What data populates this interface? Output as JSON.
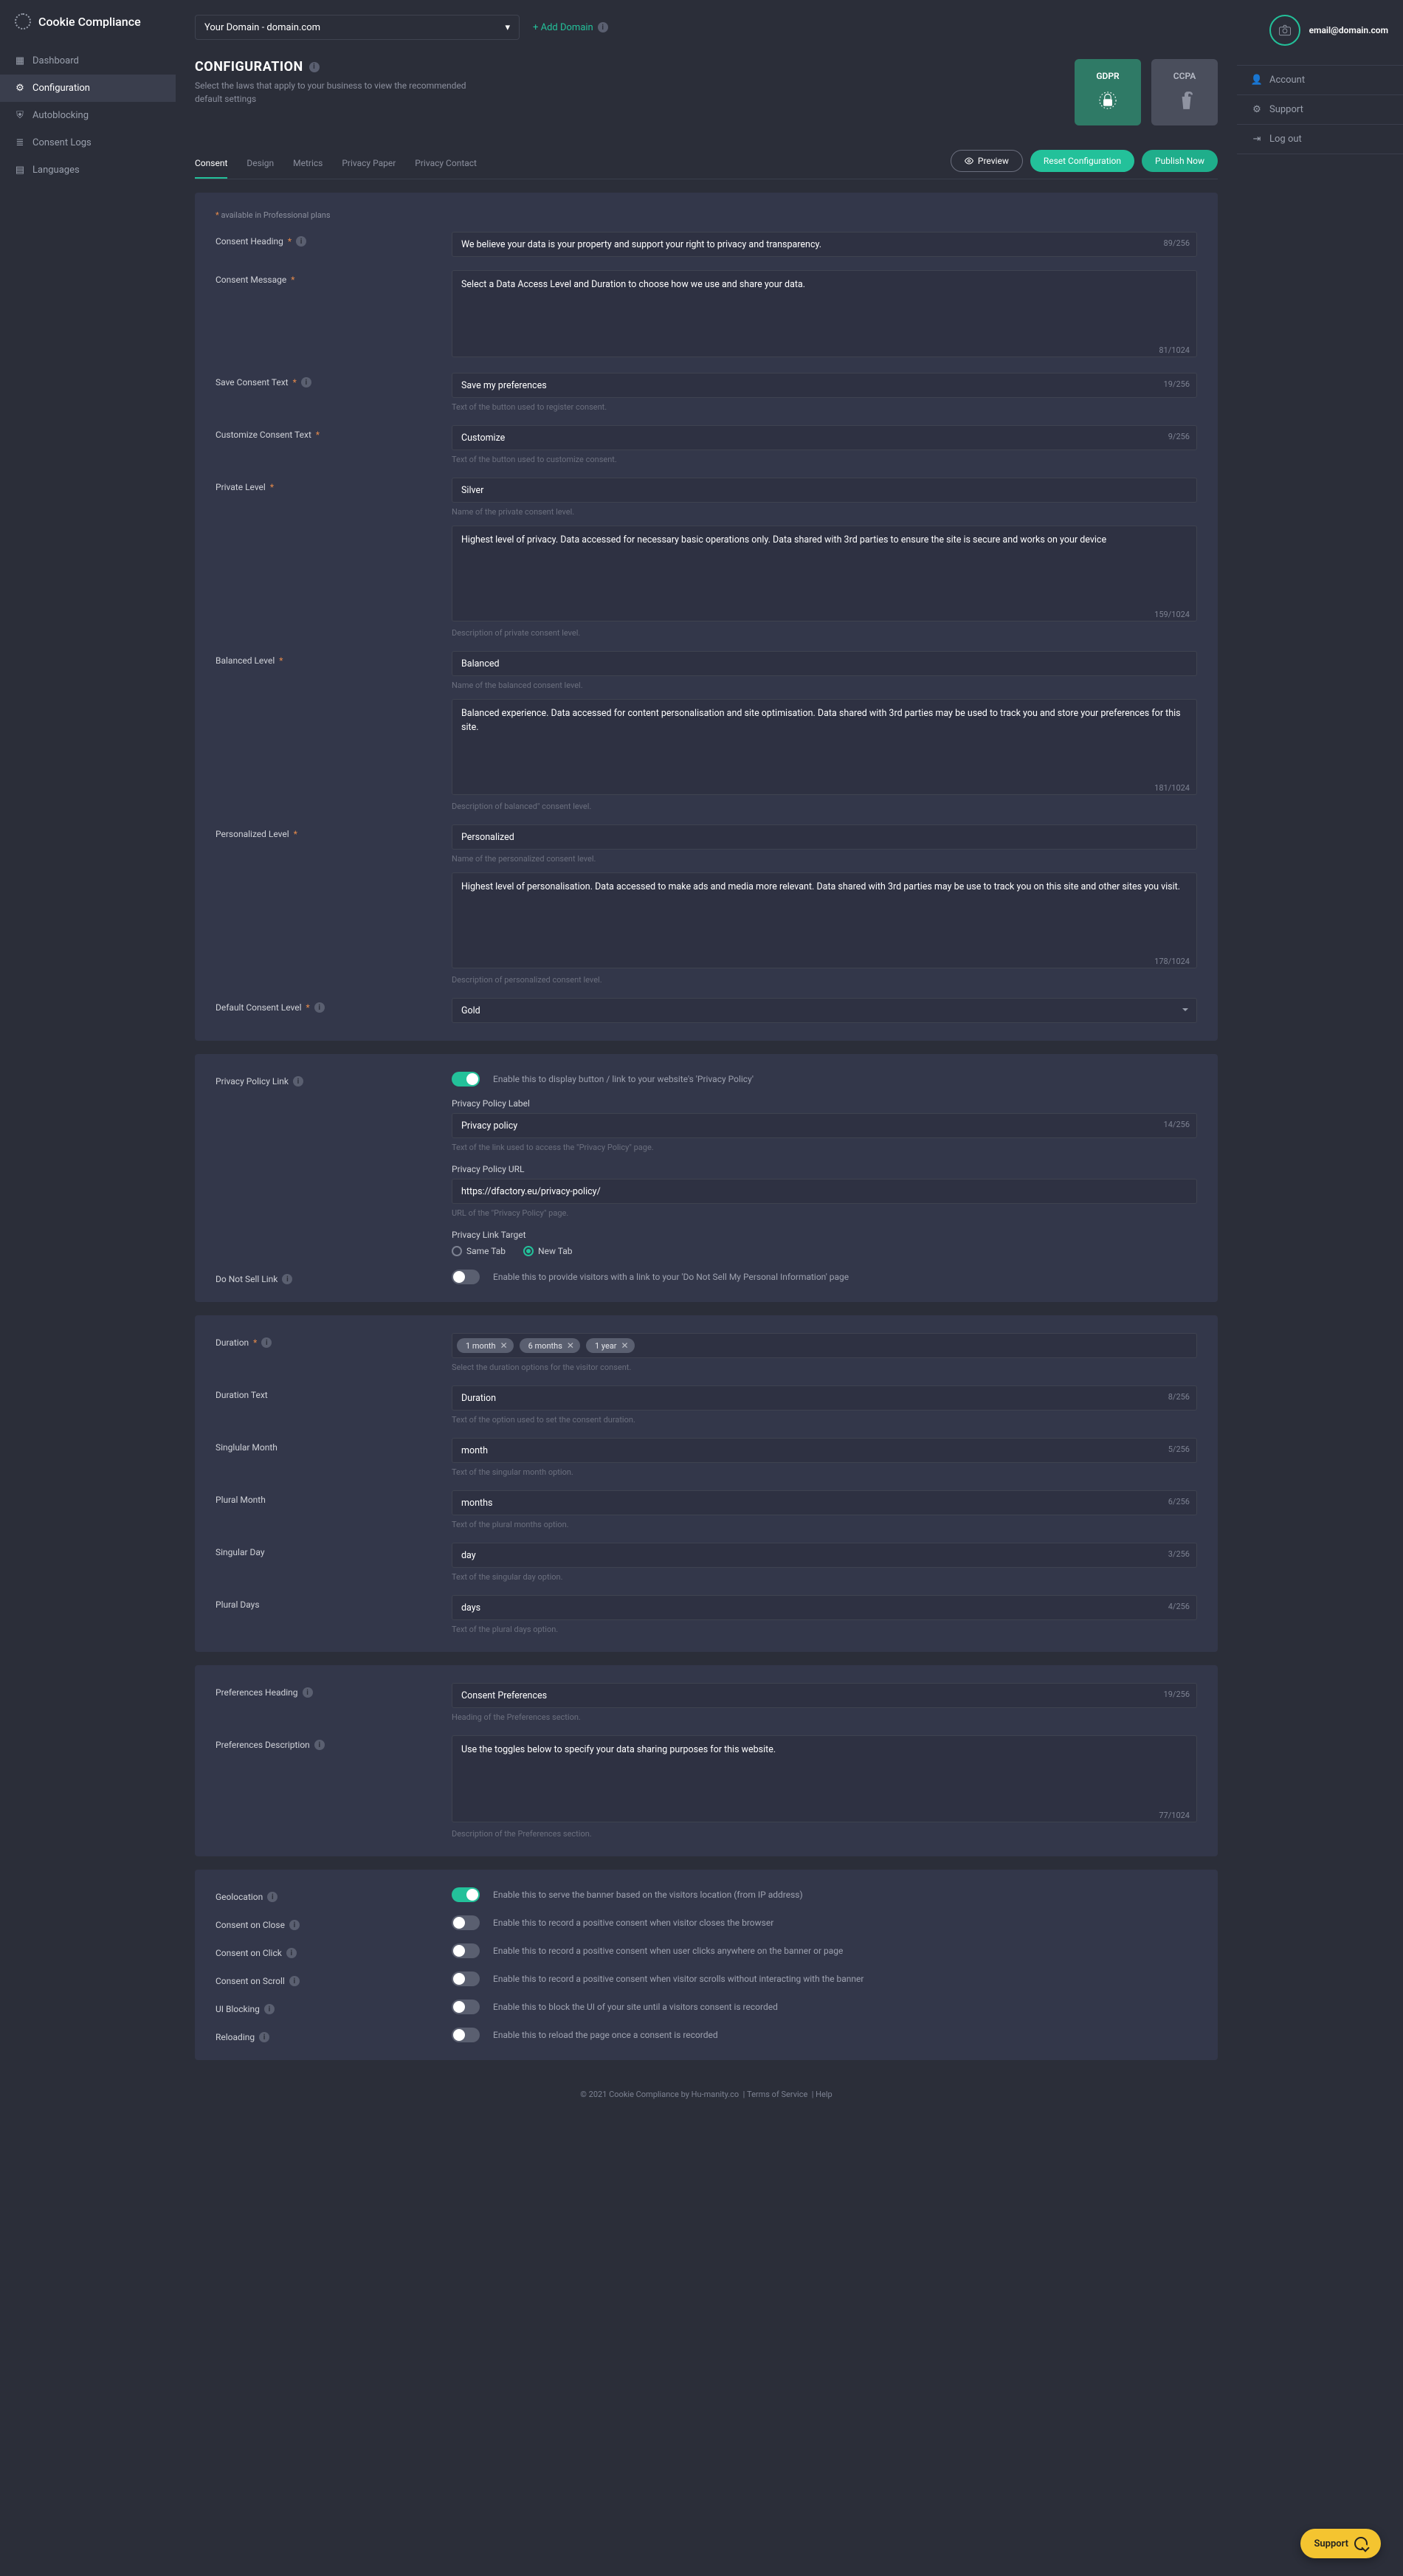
{
  "brand": "Cookie Compliance",
  "leftNav": [
    {
      "icon": "dashboard",
      "label": "Dashboard"
    },
    {
      "icon": "gear",
      "label": "Configuration",
      "active": true
    },
    {
      "icon": "shield",
      "label": "Autoblocking"
    },
    {
      "icon": "list",
      "label": "Consent Logs"
    },
    {
      "icon": "globe",
      "label": "Languages"
    }
  ],
  "rightRail": {
    "email": "email@domain.com",
    "items": [
      {
        "icon": "user",
        "label": "Account"
      },
      {
        "icon": "gear",
        "label": "Support"
      },
      {
        "icon": "logout",
        "label": "Log out"
      }
    ]
  },
  "top": {
    "domain": "Your Domain - domain.com",
    "addDomain": "+ Add Domain"
  },
  "page": {
    "title": "CONFIGURATION",
    "subtitle": "Select the laws that apply to your business to view the recommended default settings"
  },
  "laws": [
    {
      "code": "GDPR",
      "active": true
    },
    {
      "code": "CCPA",
      "active": false
    }
  ],
  "tabs": [
    "Consent",
    "Design",
    "Metrics",
    "Privacy Paper",
    "Privacy Contact"
  ],
  "activeTab": "Consent",
  "buttons": {
    "preview": "Preview",
    "reset": "Reset Configuration",
    "publish": "Publish Now"
  },
  "proNote": "available in Professional plans",
  "consent": {
    "heading": {
      "label": "Consent Heading",
      "value": "We believe your data is your property and support your right to privacy and transparency.",
      "counter": "89/256"
    },
    "message": {
      "label": "Consent Message",
      "value": "Select a Data Access Level and Duration to choose how we use and share your data.",
      "counter": "81/1024"
    },
    "saveText": {
      "label": "Save Consent Text",
      "value": "Save my preferences",
      "counter": "19/256",
      "hint": "Text of the button used to register consent."
    },
    "customizeText": {
      "label": "Customize Consent Text",
      "value": "Customize",
      "counter": "9/256",
      "hint": "Text of the button used to customize consent."
    },
    "private": {
      "label": "Private Level",
      "name": "Silver",
      "nameHint": "Name of the private consent level.",
      "desc": "Highest level of privacy. Data accessed for necessary basic operations only. Data shared with 3rd parties to ensure the site is secure and works on your device",
      "descCounter": "159/1024",
      "descHint": "Description of private consent level."
    },
    "balanced": {
      "label": "Balanced Level",
      "name": "Balanced",
      "nameHint": "Name of the balanced consent level.",
      "desc": "Balanced experience. Data accessed for content personalisation and site optimisation. Data shared with 3rd parties may be used to track you and store your preferences for this site.",
      "descCounter": "181/1024",
      "descHint": "Description of balanced\" consent level."
    },
    "personalized": {
      "label": "Personalized Level",
      "name": "Personalized",
      "nameHint": "Name of the personalized consent level.",
      "desc": "Highest level of personalisation. Data accessed to make ads and media more relevant. Data shared with 3rd parties may be use to track you on this site and other sites you visit.",
      "descCounter": "178/1024",
      "descHint": "Description of personalized consent level."
    },
    "defaultLevel": {
      "label": "Default Consent Level",
      "value": "Gold"
    }
  },
  "privacy": {
    "link": {
      "label": "Privacy Policy Link",
      "toggleText": "Enable this to display button / link to your website's 'Privacy Policy'",
      "on": true
    },
    "labelField": {
      "heading": "Privacy Policy Label",
      "value": "Privacy policy",
      "counter": "14/256",
      "hint": "Text of the link used to access the \"Privacy Policy\" page."
    },
    "url": {
      "heading": "Privacy Policy URL",
      "value": "https://dfactory.eu/privacy-policy/",
      "hint": "URL of the \"Privacy Policy\" page."
    },
    "target": {
      "heading": "Privacy Link Target",
      "opts": [
        "Same Tab",
        "New Tab"
      ],
      "selected": "New Tab"
    },
    "dns": {
      "label": "Do Not Sell Link",
      "toggleText": "Enable this to provide visitors with a link to your 'Do Not Sell My Personal Information' page",
      "on": false
    }
  },
  "duration": {
    "label": "Duration",
    "chips": [
      "1 month",
      "6 months",
      "1 year"
    ],
    "hint": "Select the duration options for the visitor consent.",
    "text": {
      "label": "Duration Text",
      "value": "Duration",
      "counter": "8/256",
      "hint": "Text of the option used to set the consent duration."
    },
    "singularMonth": {
      "label": "Singlular Month",
      "value": "month",
      "counter": "5/256",
      "hint": "Text of the singular month option."
    },
    "pluralMonth": {
      "label": "Plural Month",
      "value": "months",
      "counter": "6/256",
      "hint": "Text of the plural months option."
    },
    "singularDay": {
      "label": "Singular Day",
      "value": "day",
      "counter": "3/256",
      "hint": "Text of the singular day option."
    },
    "pluralDays": {
      "label": "Plural Days",
      "value": "days",
      "counter": "4/256",
      "hint": "Text of the plural days option."
    }
  },
  "prefs": {
    "heading": {
      "label": "Preferences Heading",
      "value": "Consent Preferences",
      "counter": "19/256",
      "hint": "Heading of the Preferences section."
    },
    "desc": {
      "label": "Preferences Description",
      "value": "Use the toggles below to specify your data sharing purposes for this website.",
      "counter": "77/1024",
      "hint": "Description of the Preferences section."
    }
  },
  "behaviors": [
    {
      "key": "geo",
      "label": "Geolocation",
      "text": "Enable this to serve the banner based on the visitors location (from IP address)",
      "on": true
    },
    {
      "key": "close",
      "label": "Consent on Close",
      "text": "Enable this to record a positive consent when visitor closes the browser",
      "on": false
    },
    {
      "key": "click",
      "label": "Consent on Click",
      "text": "Enable this to record a positive consent when user clicks anywhere on the banner or page",
      "on": false
    },
    {
      "key": "scroll",
      "label": "Consent on Scroll",
      "text": "Enable this to record a positive consent when visitor scrolls without interacting with the banner",
      "on": false
    },
    {
      "key": "ui",
      "label": "UI Blocking",
      "text": "Enable this to block the UI of your site until a visitors consent is recorded",
      "on": false
    },
    {
      "key": "reload",
      "label": "Reloading",
      "text": "Enable this to reload the page once a consent is recorded",
      "on": false
    }
  ],
  "footer": {
    "copyright": "© 2021 Cookie Compliance by Hu-manity.co",
    "links": [
      "Terms of Service",
      "Help"
    ]
  },
  "fab": "Support"
}
